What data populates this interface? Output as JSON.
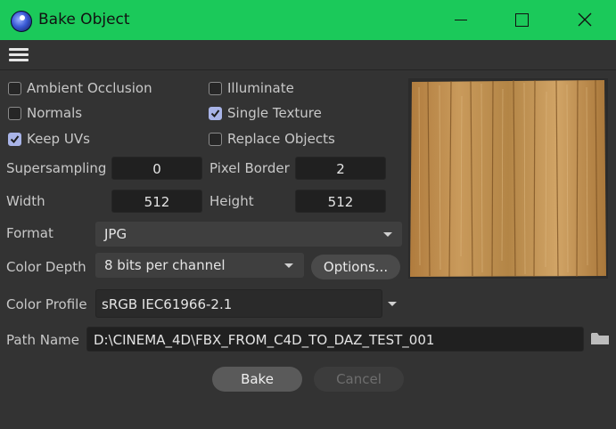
{
  "window": {
    "title": "Bake Object",
    "controls": [
      "minimize-icon",
      "maximize-icon",
      "close-icon"
    ]
  },
  "menu": {
    "icon": "hamburger-menu-icon"
  },
  "options": {
    "ambient_occlusion": {
      "label": "Ambient Occlusion",
      "checked": false
    },
    "illuminate": {
      "label": "Illuminate",
      "checked": false
    },
    "normals": {
      "label": "Normals",
      "checked": false
    },
    "single_texture": {
      "label": "Single Texture",
      "checked": true
    },
    "keep_uvs": {
      "label": "Keep UVs",
      "checked": true
    },
    "replace_objects": {
      "label": "Replace Objects",
      "checked": false
    }
  },
  "fields": {
    "supersampling_label": "Supersampling",
    "supersampling_value": "0",
    "pixel_border_label": "Pixel Border",
    "pixel_border_value": "2",
    "width_label": "Width",
    "width_value": "512",
    "height_label": "Height",
    "height_value": "512",
    "format_label": "Format",
    "format_value": "JPG",
    "color_depth_label": "Color Depth",
    "color_depth_value": "8 bits per channel",
    "options_button": "Options...",
    "color_profile_label": "Color Profile",
    "color_profile_value": "sRGB IEC61966-2.1",
    "path_name_label": "Path Name",
    "path_name_value": "D:\\CINEMA_4D\\FBX_FROM_C4D_TO_DAZ_TEST_001",
    "folder_icon": "folder-icon"
  },
  "buttons": {
    "bake": "Bake",
    "cancel": "Cancel"
  },
  "preview": {
    "description_icon": "texture-preview-image"
  },
  "colors": {
    "titlebar": "#1bc95a",
    "background": "#333333",
    "checkbox_checked": "#a9b4e8"
  }
}
